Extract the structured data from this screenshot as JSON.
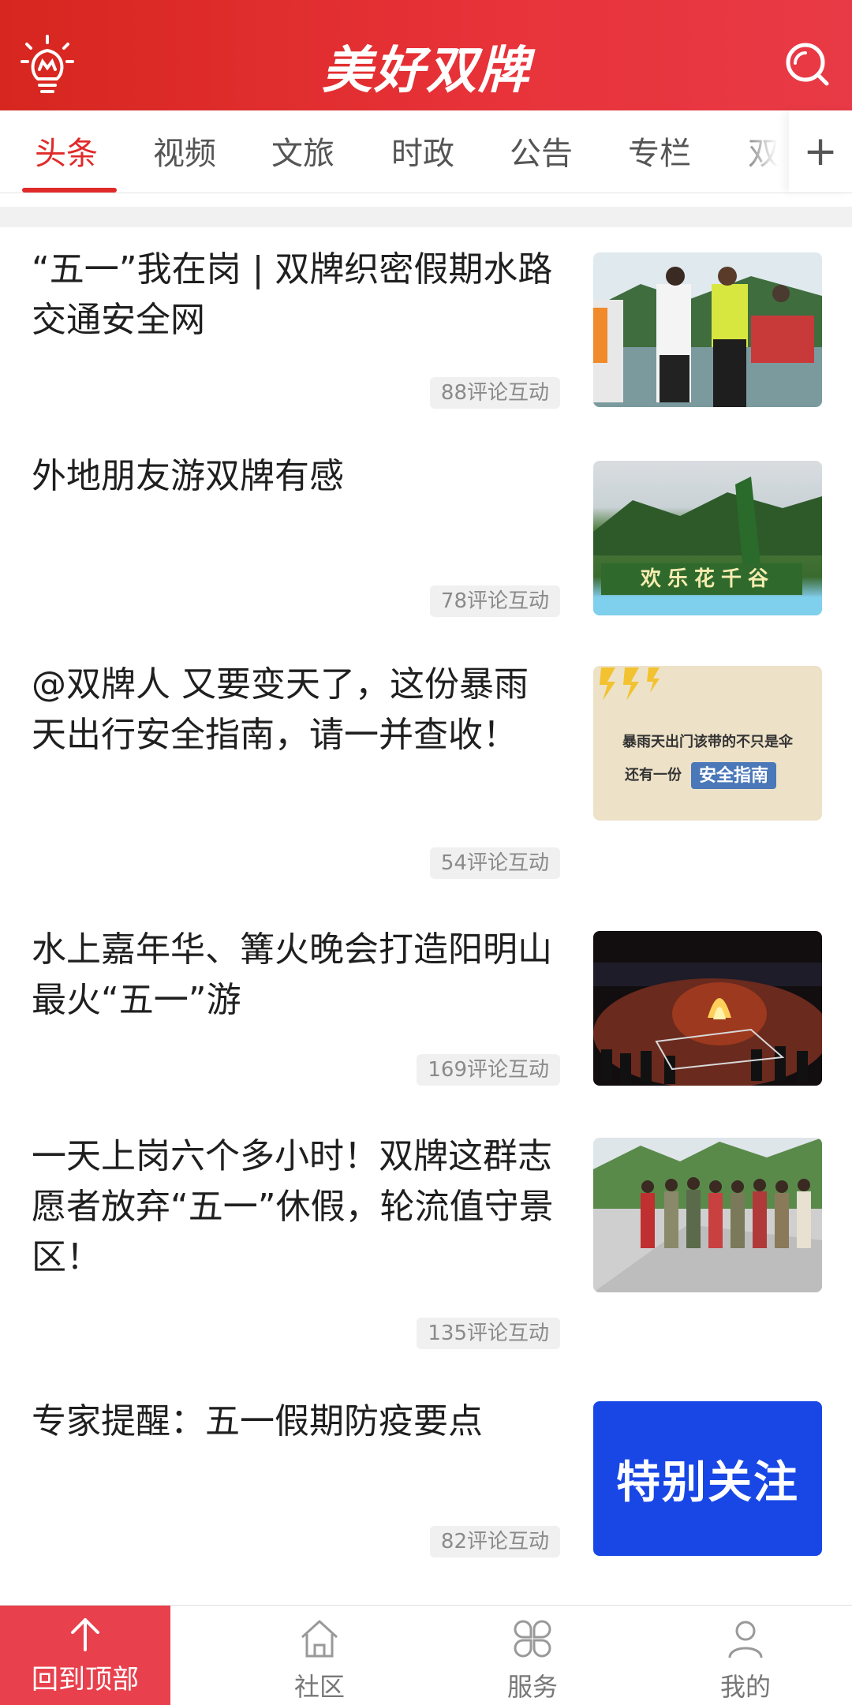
{
  "header": {
    "logo": "美好双牌"
  },
  "tabs": [
    {
      "label": "头条"
    },
    {
      "label": "视频"
    },
    {
      "label": "文旅"
    },
    {
      "label": "时政"
    },
    {
      "label": "公告"
    },
    {
      "label": "专栏"
    },
    {
      "label": "双"
    }
  ],
  "tabs_plus": "+",
  "articles": [
    {
      "title": "“五一”我在岗 | 双牌织密假期水路交通安全网",
      "comments": "88评论互动"
    },
    {
      "title": "外地朋友游双牌有感",
      "comments": "78评论互动",
      "thumb_text": "欢乐花千谷"
    },
    {
      "title": "@双牌人 又要变天了，这份暴雨天出行安全指南，请一并查收！",
      "comments": "54评论互动",
      "thumb_line1": "暴雨天出门该带的不只是伞",
      "thumb_line2_prefix": "还有一份",
      "thumb_line2_box": "安全指南"
    },
    {
      "title": "水上嘉年华、篝火晚会打造阳明山最火“五一”游",
      "comments": "169评论互动"
    },
    {
      "title": "一天上岗六个多小时！双牌这群志愿者放弃“五一”休假，轮流值守景区！",
      "comments": "135评论互动"
    },
    {
      "title": "专家提醒：五一假期防疫要点",
      "comments": "82评论互动",
      "thumb_text": "特别关注"
    }
  ],
  "bottom_nav": {
    "back_top": "回到顶部",
    "items": [
      {
        "label": "社区"
      },
      {
        "label": "服务"
      },
      {
        "label": "我的"
      }
    ]
  },
  "colors": {
    "brand": "#e02a2a",
    "header": "#e02a2a"
  }
}
